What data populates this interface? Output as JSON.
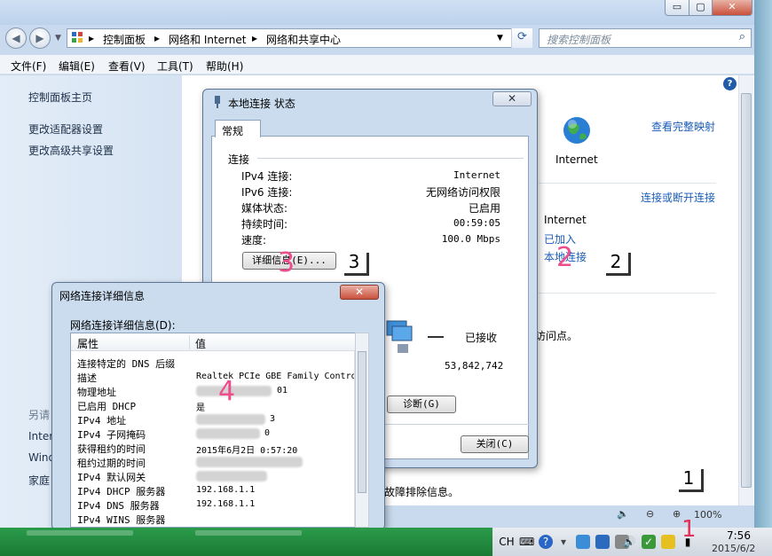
{
  "explorer": {
    "breadcrumbs": [
      "控制面板",
      "网络和 Internet",
      "网络和共享中心"
    ],
    "search_placeholder": "搜索控制面板",
    "caption": {
      "minimize": "▭",
      "maximize": "▢",
      "close": "✕"
    },
    "menus": [
      "文件(F)",
      "编辑(E)",
      "查看(V)",
      "工具(T)",
      "帮助(H)"
    ],
    "sidebar": {
      "items": [
        "控制面板主页",
        "更改适配器设置",
        "更改高级共享设置"
      ],
      "see_also": "另请",
      "bottom": [
        "Inter",
        "Wind",
        "家庭"
      ]
    },
    "content": {
      "view_full_map": "查看完整映射",
      "internet_label": "Internet",
      "connect_disconnect": "连接或断开连接",
      "access_type_value": "Internet",
      "homegroup_value": "已加入",
      "connection_link": "本地连接",
      "access_point_fragment": "访问点。",
      "troubleshoot_fragment": "故障排除信息。"
    },
    "zoom": "100%"
  },
  "status_dialog": {
    "title": "本地连接 状态",
    "tab": "常规",
    "section_connection": "连接",
    "rows": [
      {
        "label": "IPv4 连接:",
        "value": "Internet"
      },
      {
        "label": "IPv6 连接:",
        "value": "无网络访问权限"
      },
      {
        "label": "媒体状态:",
        "value": "已启用"
      },
      {
        "label": "持续时间:",
        "value": "00:59:05"
      },
      {
        "label": "速度:",
        "value": "100.0 Mbps"
      }
    ],
    "details_button": "详细信息(E)...",
    "received_label": "已接收",
    "received_value": "53,842,742",
    "diagnose_button": "诊断(G)",
    "close_button": "关闭(C)"
  },
  "detail_dialog": {
    "title": "网络连接详细信息",
    "subtitle": "网络连接详细信息(D):",
    "col_property": "属性",
    "col_value": "值",
    "rows": [
      {
        "p": "连接特定的 DNS 后缀",
        "v": ""
      },
      {
        "p": "描述",
        "v": "Realtek PCIe GBE Family Contro"
      },
      {
        "p": "物理地址",
        "v": "01"
      },
      {
        "p": "已启用 DHCP",
        "v": "是"
      },
      {
        "p": "IPv4 地址",
        "v": "3"
      },
      {
        "p": "IPv4 子网掩码",
        "v": "0"
      },
      {
        "p": "获得租约的时间",
        "v": "2015年6月2日 0:57:20"
      },
      {
        "p": "租约过期的时间",
        "v": ""
      },
      {
        "p": "IPv4 默认网关",
        "v": ""
      },
      {
        "p": "IPv4 DHCP 服务器",
        "v": "192.168.1.1"
      },
      {
        "p": "IPv4 DNS 服务器",
        "v": "192.168.1.1"
      },
      {
        "p": "IPv4 WINS 服务器",
        "v": ""
      }
    ]
  },
  "annotations": {
    "black": [
      "3",
      "2",
      "1"
    ],
    "pink": [
      "3",
      "2",
      "4",
      "1"
    ]
  },
  "taskbar": {
    "lang": "CH",
    "time": "7:56",
    "date": "2015/6/2"
  }
}
